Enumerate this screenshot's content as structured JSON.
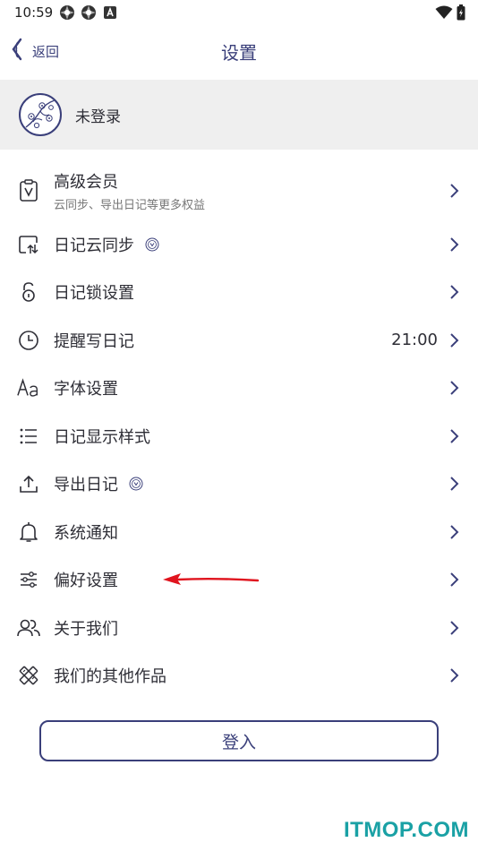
{
  "status_bar": {
    "time": "10:59",
    "left_icons": [
      "app-icon",
      "app-icon",
      "a-icon"
    ],
    "right_icons": [
      "wifi-icon",
      "battery-icon"
    ]
  },
  "nav": {
    "back_label": "返回",
    "title": "设置"
  },
  "profile": {
    "name": "未登录"
  },
  "menu": {
    "items": [
      {
        "icon": "vip-card-icon",
        "label": "高级会员",
        "sub": "云同步、导出日记等更多权益",
        "value": "",
        "vip": false
      },
      {
        "icon": "cloud-sync-icon",
        "label": "日记云同步",
        "sub": "",
        "value": "",
        "vip": true
      },
      {
        "icon": "lock-icon",
        "label": "日记锁设置",
        "sub": "",
        "value": "",
        "vip": false
      },
      {
        "icon": "clock-icon",
        "label": "提醒写日记",
        "sub": "",
        "value": "21:00",
        "vip": false
      },
      {
        "icon": "font-icon",
        "label": "字体设置",
        "sub": "",
        "value": "",
        "vip": false
      },
      {
        "icon": "list-icon",
        "label": "日记显示样式",
        "sub": "",
        "value": "",
        "vip": false
      },
      {
        "icon": "upload-icon",
        "label": "导出日记",
        "sub": "",
        "value": "",
        "vip": true
      },
      {
        "icon": "bell-icon",
        "label": "系统通知",
        "sub": "",
        "value": "",
        "vip": false
      },
      {
        "icon": "sliders-icon",
        "label": "偏好设置",
        "sub": "",
        "value": "",
        "vip": false
      },
      {
        "icon": "people-icon",
        "label": "关于我们",
        "sub": "",
        "value": "",
        "vip": false
      },
      {
        "icon": "tools-icon",
        "label": "我们的其他作品",
        "sub": "",
        "value": "",
        "vip": false
      }
    ]
  },
  "login_button": {
    "label": "登入"
  },
  "watermark": "ITMOP.COM",
  "colors": {
    "accent": "#3a3f7a",
    "profile_bg": "#efefef",
    "annotation_arrow": "#e0141e",
    "watermark": "#1aa1a5"
  }
}
